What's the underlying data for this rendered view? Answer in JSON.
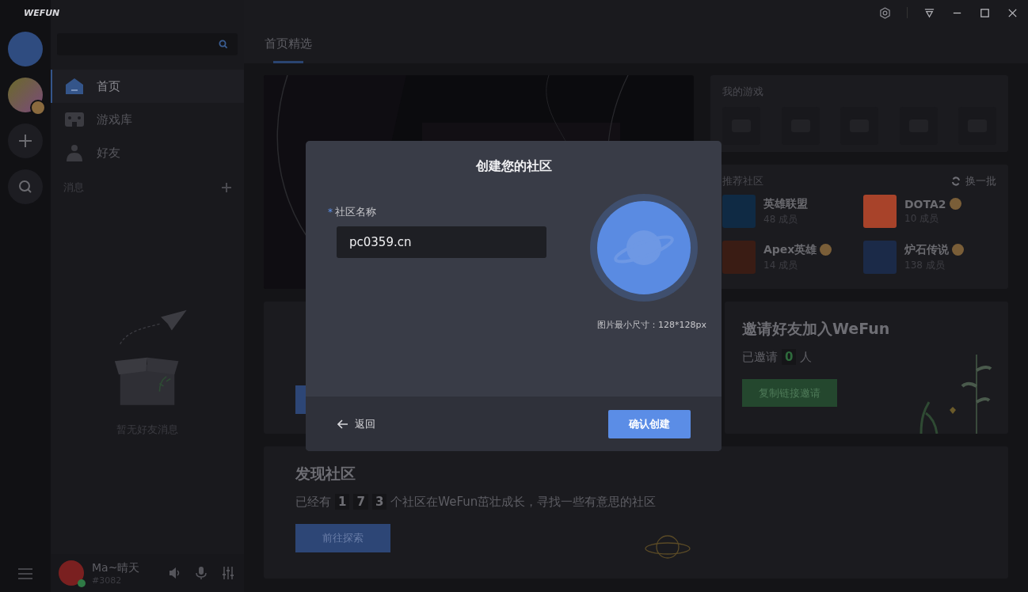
{
  "app": {
    "logo": "WEFUN"
  },
  "sidebar": {
    "nav": [
      {
        "label": "首页",
        "selected": true,
        "kind": "home"
      },
      {
        "label": "游戏库",
        "selected": false,
        "kind": "games"
      },
      {
        "label": "好友",
        "selected": false,
        "kind": "friends"
      }
    ],
    "messages_label": "消息",
    "empty_text": "暂无好友消息"
  },
  "user": {
    "name": "Ma~晴天",
    "tag": "#3082",
    "online": true
  },
  "tabs": [
    {
      "label": "首页精选",
      "selected": true
    }
  ],
  "my_games": {
    "title": "我的游戏"
  },
  "recommended": {
    "title": "推荐社区",
    "refresh": "换一批",
    "items": [
      {
        "name": "英雄联盟",
        "members": "48 成员",
        "badge": false,
        "color": "#0f2a44"
      },
      {
        "name": "DOTA2",
        "members": "10 成员",
        "badge": true,
        "color": "#a8432a"
      },
      {
        "name": "Apex英雄",
        "members": "14 成员",
        "badge": true,
        "color": "#3a1c14"
      },
      {
        "name": "炉石传说",
        "members": "138 成员",
        "badge": true,
        "color": "#1b2a48"
      }
    ]
  },
  "invite": {
    "title": "邀请好友加入WeFun",
    "prefix": "已邀请",
    "count": "0",
    "suffix": "人",
    "button": "复制链接邀请"
  },
  "discover": {
    "title": "发现社区",
    "prefix": "已经有",
    "digits": [
      "1",
      "7",
      "3"
    ],
    "suffix": "个社区在WeFun茁壮成长，寻找一些有意思的社区",
    "button": "前往探索"
  },
  "dialog": {
    "title": "创建您的社区",
    "required_mark": "*",
    "field_label": "社区名称",
    "value": "pc0359.cn",
    "hint": "图片最小尺寸：128*128px",
    "back": "返回",
    "confirm": "确认创建"
  }
}
